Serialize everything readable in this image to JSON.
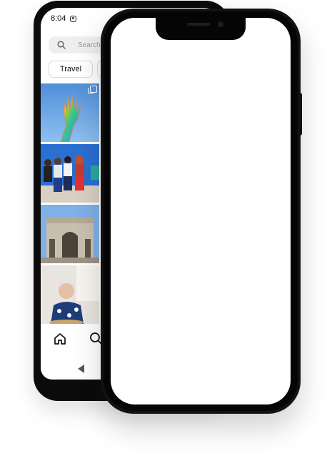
{
  "android": {
    "status_time": "8:04",
    "search_placeholder": "Search",
    "chips": [
      "Travel"
    ],
    "grid_tiles": [
      {
        "subject": "hand with rainbow sequins against blue sky",
        "multi": true
      },
      {
        "subject": "group of friends sitting on wall"
      },
      {
        "subject": "triumphal arch"
      },
      {
        "subject": "woman eating at table"
      }
    ],
    "nav_icons": [
      "home-icon",
      "search-icon",
      "back-icon"
    ]
  },
  "iphone": {
    "screen": "blank"
  },
  "colors": {
    "phone_body": "#0b0b0b",
    "search_bg": "#efefef",
    "sky_blue": "#5c9be0",
    "page_bg": "#ffffff"
  }
}
